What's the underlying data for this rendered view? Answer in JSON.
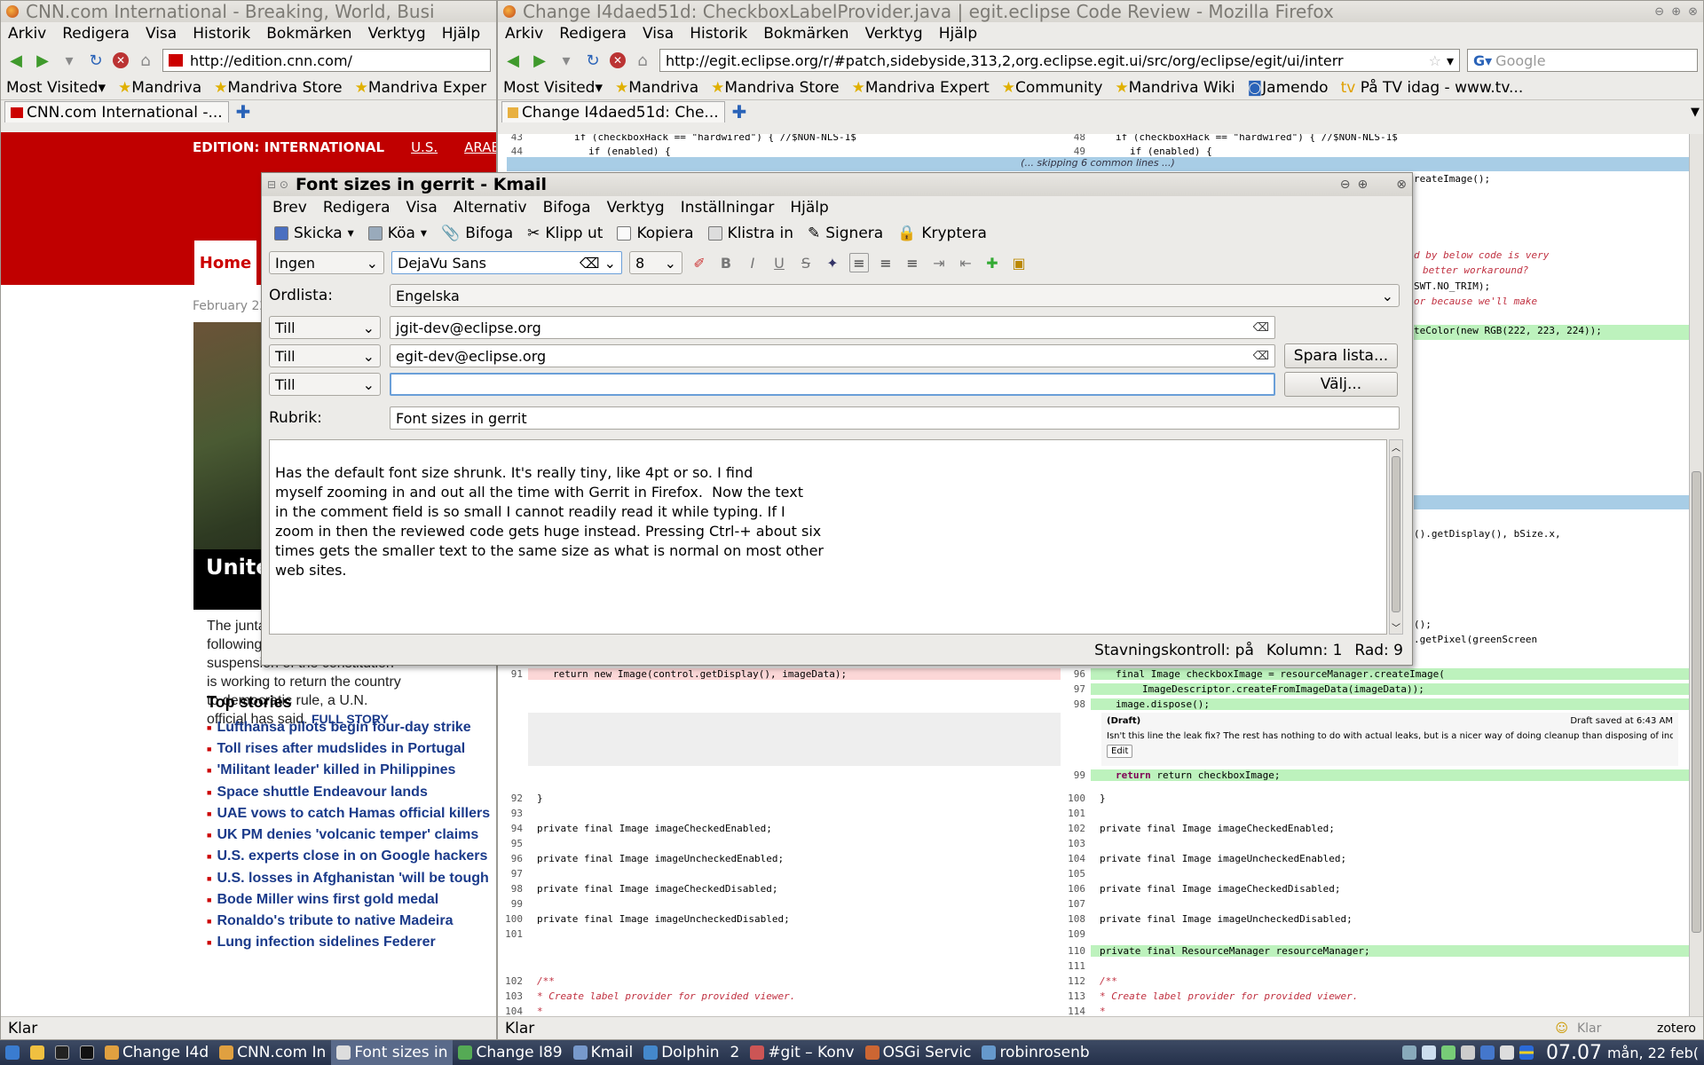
{
  "cnn_window": {
    "title": "CNN.com International - Breaking, World, Busi",
    "menu": [
      "Arkiv",
      "Redigera",
      "Visa",
      "Historik",
      "Bokmärken",
      "Verktyg",
      "Hjälp"
    ],
    "url": "http://edition.cnn.com/",
    "bookmarks": [
      "Most Visited",
      "Mandriva",
      "Mandriva Store",
      "Mandriva Exper"
    ],
    "tab": "CNN.com International -...",
    "edition_label": "EDITION:  INTERNATIONAL",
    "edition_us": "U.S.",
    "edition_arab": "ARAB",
    "nav_home": "Home",
    "date": "February 22",
    "headline": "United wants",
    "blurb": "The junta leading Niger following last week's coup and suspension of the constitution is working to return the country to democratic rule, a U.N. official has said.",
    "full_story": "FULL STORY",
    "top_stories_title": "Top stories",
    "top_stories": [
      "Lufthansa pilots begin four-day strike",
      "Toll rises after mudslides in Portugal",
      "'Militant leader' killed in Philippines",
      "Space shuttle Endeavour lands",
      "UAE vows to catch Hamas official killers",
      "UK PM denies 'volcanic temper' claims",
      "U.S. experts close in on Google hackers",
      "U.S. losses in Afghanistan 'will be tough",
      "Bode Miller wins first gold medal",
      "Ronaldo's tribute to native Madeira",
      "Lung infection sidelines Federer"
    ],
    "status": "Klar"
  },
  "gerrit_window": {
    "title": "Change I4daed51d: CheckboxLabelProvider.java | egit.eclipse Code Review - Mozilla Firefox",
    "menu": [
      "Arkiv",
      "Redigera",
      "Visa",
      "Historik",
      "Bokmärken",
      "Verktyg",
      "Hjälp"
    ],
    "url": "http://egit.eclipse.org/r/#patch,sidebyside,313,2,org.eclipse.egit.ui/src/org/eclipse/egit/ui/interr",
    "search_placeholder": "Google",
    "bookmarks": [
      "Most Visited",
      "Mandriva",
      "Mandriva Store",
      "Mandriva Expert",
      "Community",
      "Mandriva Wiki",
      "Jamendo",
      "På TV idag - www.tv..."
    ],
    "tab": "Change I4daed51d: Che...",
    "skip_text": "(... skipping 6 common lines ...)",
    "top_rows": [
      {
        "l": "43",
        "lc": "if (checkboxHack == \"hardwired\") { //$NON-NLS-1$",
        "r": "48",
        "rc": "if (checkboxHack == \"hardwired\") { //$NON-NLS-1$"
      },
      {
        "l": "44",
        "lc": "if (enabled) {",
        "r": "49",
        "rc": "if (enabled) {"
      }
    ],
    "peek_lines": [
      "reateImage();",
      "d by below code is very",
      "better workaround?",
      "SWT.NO_TRIM);",
      "or because we'll make",
      "teColor(new RGB(222, 223, 224));",
      "().getDisplay(), bSize.x,",
      "();",
      ".getPixel(greenScreen"
    ],
    "row91": {
      "l": "91",
      "lc": "return new Image(control.getDisplay(), imageData);",
      "r": "96",
      "rc": "final Image checkboxImage = resourceManager.createImage("
    },
    "row97": {
      "r": "97",
      "rc": "ImageDescriptor.createFromImageData(imageData));"
    },
    "row98": {
      "r": "98",
      "rc": "image.dispose();"
    },
    "draft_label": "(Draft)",
    "draft_saved": "Draft saved at 6:43 AM",
    "draft_text": "Isn't this line the leak fix? The rest has nothing to do with actual leaks, but is a nicer way of doing cleanup than disposing of individual resources?",
    "edit_btn": "Edit",
    "row99": {
      "r": "99",
      "rc": "return checkboxImage;"
    },
    "rows": [
      {
        "l": "92",
        "lc": "}",
        "r": "100",
        "rc": "}"
      },
      {
        "l": "93",
        "lc": "",
        "r": "101",
        "rc": ""
      },
      {
        "l": "94",
        "lc": "private final Image imageCheckedEnabled;",
        "r": "102",
        "rc": "private final Image imageCheckedEnabled;"
      },
      {
        "l": "95",
        "lc": "",
        "r": "103",
        "rc": ""
      },
      {
        "l": "96",
        "lc": "private final Image imageUncheckedEnabled;",
        "r": "104",
        "rc": "private final Image imageUncheckedEnabled;"
      },
      {
        "l": "97",
        "lc": "",
        "r": "105",
        "rc": ""
      },
      {
        "l": "98",
        "lc": "private final Image imageCheckedDisabled;",
        "r": "106",
        "rc": "private final Image imageCheckedDisabled;"
      },
      {
        "l": "99",
        "lc": "",
        "r": "107",
        "rc": ""
      },
      {
        "l": "100",
        "lc": "private final Image imageUncheckedDisabled;",
        "r": "108",
        "rc": "private final Image imageUncheckedDisabled;"
      },
      {
        "l": "101",
        "lc": "",
        "r": "109",
        "rc": ""
      }
    ],
    "added": [
      {
        "r": "110",
        "rc": "private final ResourceManager resourceManager;"
      },
      {
        "r": "111",
        "rc": ""
      }
    ],
    "bottom_rows": [
      {
        "l": "102",
        "lc": "/**",
        "r": "112",
        "rc": "/**"
      },
      {
        "l": "103",
        "lc": " * Create label provider for provided viewer.",
        "r": "113",
        "rc": " * Create label provider for provided viewer."
      },
      {
        "l": "104",
        "lc": " *",
        "r": "114",
        "rc": " *"
      }
    ],
    "status": "Klar",
    "status_right": "Klar",
    "zotero": "zotero"
  },
  "kmail": {
    "title": "Font sizes in gerrit - Kmail",
    "menu": [
      "Brev",
      "Redigera",
      "Visa",
      "Alternativ",
      "Bifoga",
      "Verktyg",
      "Inställningar",
      "Hjälp"
    ],
    "toolbar": {
      "send": "Skicka",
      "queue": "Köa",
      "attach": "Bifoga",
      "cut": "Klipp ut",
      "copy": "Kopiera",
      "paste": "Klistra in",
      "sign": "Signera",
      "encrypt": "Kryptera"
    },
    "format": {
      "style": "Ingen",
      "font": "DejaVu Sans",
      "size": "8"
    },
    "dictionary_label": "Ordlista:",
    "dictionary_value": "Engelska",
    "recipients": [
      {
        "type": "Till",
        "value": "jgit-dev@eclipse.org"
      },
      {
        "type": "Till",
        "value": "egit-dev@eclipse.org"
      },
      {
        "type": "Till",
        "value": ""
      }
    ],
    "save_list_btn": "Spara lista...",
    "choose_btn": "Välj...",
    "subject_label": "Rubrik:",
    "subject": "Font sizes in gerrit",
    "body_lines": [
      "Has the default font size shrunk. It's really tiny, like 4pt or so. I find",
      "myself zooming in and out all the time with Gerrit in Firefox.  Now the text",
      "in the comment field is so small I cannot readily read it while typing. If I",
      "zoom in then the reviewed code gets huge instead. Pressing Ctrl-+ about six",
      "times gets the smaller text to the same size as what is normal on most other",
      "web sites."
    ],
    "status_spell": "Stavningskontroll: på",
    "status_col": "Kolumn: 1",
    "status_row": "Rad: 9"
  },
  "taskbar": {
    "tasks": [
      "Change I4d",
      "CNN.com In",
      "Font sizes in",
      "Change I89",
      "Kmail",
      "Dolphin",
      "#git – Konv",
      "OSGi Servic",
      "robinrosenb"
    ],
    "desktop": "2",
    "clock_time": "07.07",
    "clock_date": "mån, 22 feb("
  }
}
